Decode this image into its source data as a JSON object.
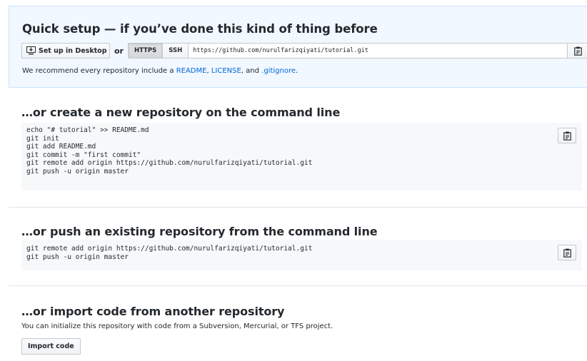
{
  "quick_setup": {
    "title": "Quick setup — if you’ve done this kind of thing before",
    "desktop_button": "Set up in Desktop",
    "or": "or",
    "protocols": [
      "HTTPS",
      "SSH"
    ],
    "active_protocol": "HTTPS",
    "clone_url": "https://github.com/nurulfarizqiyati/tutorial.git",
    "recommend": {
      "prefix": "We recommend every repository include a ",
      "readme": "README",
      "sep1": ", ",
      "license": "LICENSE",
      "sep2": ", and ",
      "gitignore": ".gitignore",
      "suffix": "."
    }
  },
  "create_section": {
    "title": "…or create a new repository on the command line",
    "code": "echo \"# tutorial\" >> README.md\ngit init\ngit add README.md\ngit commit -m \"first commit\"\ngit remote add origin https://github.com/nurulfarizqiyati/tutorial.git\ngit push -u origin master"
  },
  "push_section": {
    "title": "…or push an existing repository from the command line",
    "code": "git remote add origin https://github.com/nurulfarizqiyati/tutorial.git\ngit push -u origin master"
  },
  "import_section": {
    "title": "…or import code from another repository",
    "description": "You can initialize this repository with code from a Subversion, Mercurial, or TFS project.",
    "button": "Import code"
  },
  "icons": {
    "desktop": "desktop-download-icon",
    "clipboard": "clippy-icon"
  },
  "colors": {
    "quick_setup_bg": "#f1f8ff",
    "link": "#0366d6",
    "code_bg": "#f6f8fa"
  }
}
